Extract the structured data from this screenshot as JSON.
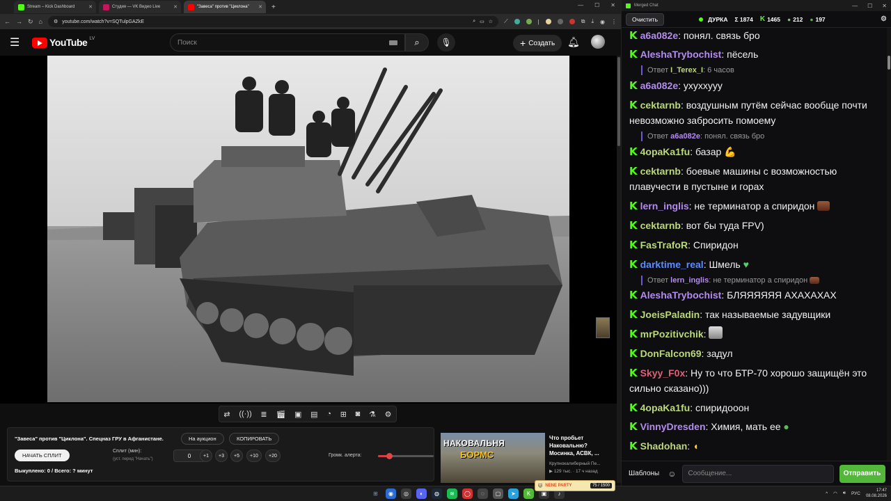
{
  "browser": {
    "tabs": [
      {
        "label": "Stream – Kick Dashboard",
        "color": "#53fc18"
      },
      {
        "label": "Студия — VK Видео Live",
        "color": "#c2185b"
      },
      {
        "label": "\"Завеса\" против \"Циклона\"",
        "color": "#ff0000"
      }
    ],
    "new_tab": "+",
    "url": "youtube.com/watch?v=SQTulpGAZkE",
    "window_controls": [
      "—",
      "☐",
      "✕"
    ]
  },
  "youtube": {
    "logo_text": "YouTube",
    "logo_sup": "LV",
    "search_placeholder": "Поиск",
    "create_label": "Создать"
  },
  "panel": {
    "video_title": "\"Завеса\" против \"Циклона\". Спецназ ГРУ в Афганистане.",
    "auction_btn": "На аукцион",
    "copy_btn": "КОПИРОВАТЬ",
    "start_split_btn": "НАЧАТЬ СПЛИТ",
    "split_label": "Сплит (мин):",
    "split_hint": "(уст. перед \"Начать\")",
    "split_value": "0",
    "steps": [
      "+1",
      "+3",
      "+5",
      "+10",
      "+20"
    ],
    "volume_label": "Громк. алерта:",
    "volume_level": 0.2,
    "bought_text": "Выкуплено: 0 / Всего: ? минут"
  },
  "recommendation": {
    "thumb_line1": "НАКОВАЛЬНЯ",
    "thumb_line2": "БОРМС",
    "title": "Что пробьет Наковальню? Мосинка, АСВК, ...",
    "channel": "Крупнокалиберный Пе...",
    "stats": "129 тыс. · 17 ч назад"
  },
  "nene": {
    "label": "NENE PARTY",
    "count": "75 / 1500"
  },
  "chat": {
    "window_title": "Merged Chat",
    "clear_btn": "Очистить",
    "channel": "ДУРКА",
    "sum": "Σ 1874",
    "kick_count": "1465",
    "vk_count": "212",
    "other_count": "197",
    "templates_btn": "Шаблоны",
    "input_placeholder": "Сообщение...",
    "send_btn": "Отправить",
    "reply_prefix": "Ответ",
    "messages": [
      {
        "nick": "a6a082e",
        "color": "#b48cf0",
        "text": ": понял. связь бро"
      },
      {
        "nick": "AleshaTrybochist",
        "color": "#b48cf0",
        "text": ": пёсель"
      },
      {
        "nick": "a6a082e",
        "color": "#b48cf0",
        "text": ": ухуххууу"
      },
      {
        "nick": "cektarnb",
        "color": "#bcd97a",
        "text": ": воздушным путём сейчас вообще почти невозможно забросить помоему"
      },
      {
        "nick": "4opaKa1fu",
        "color": "#bcd97a",
        "text": ": базар"
      },
      {
        "nick": "cektarnb",
        "color": "#bcd97a",
        "text": ": боевые машины с возможностью плавучести в пустыне и горах"
      },
      {
        "nick": "lern_inglis",
        "color": "#b48cf0",
        "text": ": не терминатор а спиридон"
      },
      {
        "nick": "cektarnb",
        "color": "#bcd97a",
        "text": ": вот бы туда FPV)"
      },
      {
        "nick": "FasTrafoR",
        "color": "#bcd97a",
        "text": ": Спиридон"
      },
      {
        "nick": "darktime_real",
        "color": "#5b8cff",
        "text": ": Шмель"
      },
      {
        "nick": "AleshaTrybochist",
        "color": "#b48cf0",
        "text": ": БЛЯЯЯЯЯЯ АХАХАХАХ"
      },
      {
        "nick": "JoeisPaladin",
        "color": "#bcd97a",
        "text": ": так называемые задувщики"
      },
      {
        "nick": "mrPozitivchik",
        "color": "#bcd97a",
        "text": ":"
      },
      {
        "nick": "DonFalcon69",
        "color": "#bcd97a",
        "text": ": задул"
      },
      {
        "nick": "Skyy_F0x",
        "color": "#e0607a",
        "text": ": Ну то что БТР-70 хорошо защищён это сильно сказано)))"
      },
      {
        "nick": "4opaKa1fu",
        "color": "#bcd97a",
        "text": ": спиридооон"
      },
      {
        "nick": "VinnyDresden",
        "color": "#b48cf0",
        "text": ": Химия, мать ее"
      },
      {
        "nick": "Shadohan",
        "color": "#bcd97a",
        "text": ":"
      }
    ],
    "replies": [
      {
        "nick": "I_Terex_I",
        "text": ": 6 часов"
      },
      {
        "nick": "a6a082e",
        "text": ": понял. связь бро"
      },
      {
        "nick": "lern_inglis",
        "text": ": не терминатор а спиридон"
      }
    ]
  },
  "taskbar": {
    "lang": "РУС",
    "time": "17:47",
    "date": "08.08.2026"
  }
}
